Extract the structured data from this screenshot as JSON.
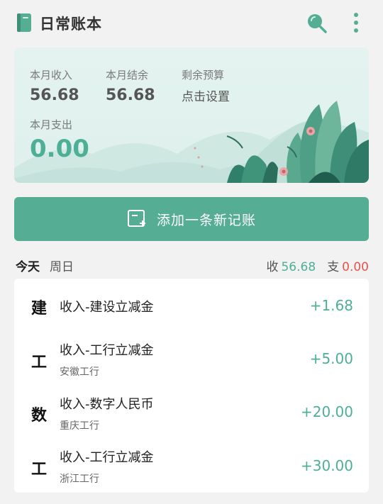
{
  "app": {
    "title": "日常账本",
    "logo_icon": "book-icon",
    "search_icon": "search-icon",
    "more_icon": "more-vertical-icon"
  },
  "colors": {
    "accent": "#55ad93",
    "income": "#4caf96",
    "expense": "#e8534a",
    "card_bg": "#e2f2ee"
  },
  "summary": {
    "month_income_label": "本月收入",
    "month_income_value": "56.68",
    "month_balance_label": "本月结余",
    "month_balance_value": "56.68",
    "budget_label": "剩余预算",
    "budget_action": "点击设置",
    "month_expense_label": "本月支出",
    "month_expense_value": "0.00"
  },
  "add_button": {
    "label": "添加一条新记账",
    "icon": "add-note-icon"
  },
  "day": {
    "today": "今天",
    "weekday": "周日",
    "income_label": "收",
    "income_value": "56.68",
    "expense_label": "支",
    "expense_value": "0.00"
  },
  "transactions": [
    {
      "char": "建",
      "title": "收入-建设立减金",
      "sub": "",
      "amount": "+1.68"
    },
    {
      "char": "工",
      "title": "收入-工行立减金",
      "sub": "安徽工行",
      "amount": "+5.00"
    },
    {
      "char": "数",
      "title": "收入-数字人民币",
      "sub": "重庆工行",
      "amount": "+20.00"
    },
    {
      "char": "工",
      "title": "收入-工行立减金",
      "sub": "浙江工行",
      "amount": "+30.00"
    }
  ]
}
